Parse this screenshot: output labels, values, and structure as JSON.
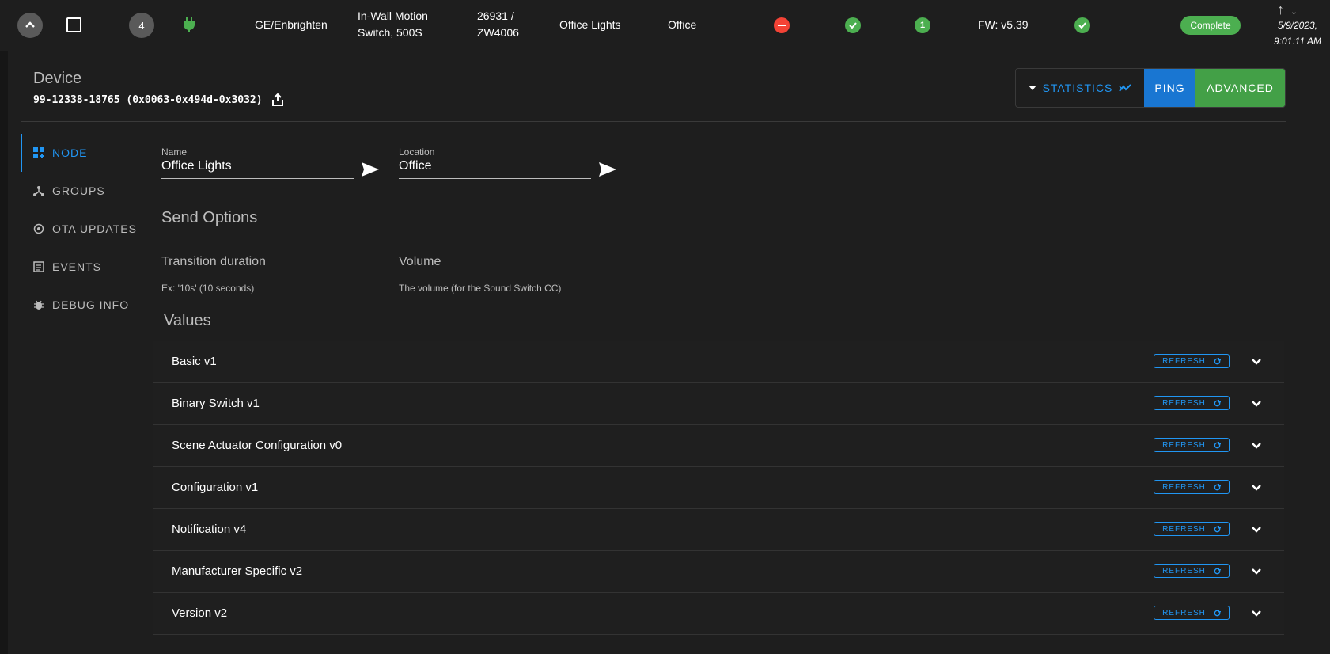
{
  "row": {
    "node_id": "4",
    "manufacturer": "GE/Enbrighten",
    "product_line1": "In-Wall Motion",
    "product_line2": "Switch, 500S",
    "code_line1": "26931 /",
    "code_line2": "ZW4006",
    "name": "Office Lights",
    "location": "Office",
    "interview_count": "1",
    "firmware": "FW: v5.39",
    "status": "Complete",
    "timestamp_line1": "5/9/2023,",
    "timestamp_line2": "9:01:11 AM",
    "arrows": "↑↓"
  },
  "device": {
    "title": "Device",
    "id": "99-12338-18765 (0x0063-0x494d-0x3032)"
  },
  "actions": {
    "statistics": "STATISTICS",
    "ping": "PING",
    "advanced": "ADVANCED"
  },
  "nav": [
    {
      "label": "NODE"
    },
    {
      "label": "GROUPS"
    },
    {
      "label": "OTA UPDATES"
    },
    {
      "label": "EVENTS"
    },
    {
      "label": "DEBUG INFO"
    }
  ],
  "fields": {
    "name_label": "Name",
    "name_value": "Office Lights",
    "location_label": "Location",
    "location_value": "Office"
  },
  "send_options": {
    "heading": "Send Options",
    "transition_placeholder": "Transition duration",
    "transition_hint": "Ex: '10s' (10 seconds)",
    "volume_placeholder": "Volume",
    "volume_hint": "The volume (for the Sound Switch CC)"
  },
  "values": {
    "heading": "Values",
    "refresh_label": "REFRESH",
    "items": [
      {
        "label": "Basic v1"
      },
      {
        "label": "Binary Switch v1"
      },
      {
        "label": "Scene Actuator Configuration v0"
      },
      {
        "label": "Configuration v1"
      },
      {
        "label": "Notification v4"
      },
      {
        "label": "Manufacturer Specific v2"
      },
      {
        "label": "Version v2"
      }
    ]
  },
  "colors": {
    "accent_blue": "#2196f3",
    "ping_blue": "#1976d2",
    "advanced_green": "#43a047",
    "ok_green": "#4caf50",
    "error_red": "#f44336"
  }
}
